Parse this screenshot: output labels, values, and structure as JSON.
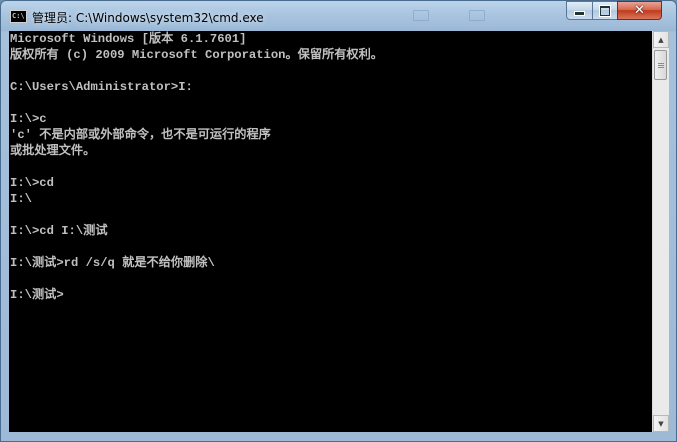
{
  "window": {
    "title": "管理员: C:\\Windows\\system32\\cmd.exe",
    "icon": "cmd-icon",
    "controls": {
      "minimize": "minimize-icon",
      "maximize": "maximize-icon",
      "close": "close-icon"
    }
  },
  "console": {
    "lines": [
      "Microsoft Windows [版本 6.1.7601]",
      "版权所有 (c) 2009 Microsoft Corporation。保留所有权利。",
      "",
      "C:\\Users\\Administrator>I:",
      "",
      "I:\\>c",
      "'c' 不是内部或外部命令，也不是可运行的程序",
      "或批处理文件。",
      "",
      "I:\\>cd",
      "I:\\",
      "",
      "I:\\>cd I:\\测试",
      "",
      "I:\\测试>rd /s/q 就是不给你删除\\",
      "",
      "I:\\测试>"
    ]
  },
  "scrollbar": {
    "up": "arrow-up-icon",
    "down": "arrow-down-icon"
  }
}
